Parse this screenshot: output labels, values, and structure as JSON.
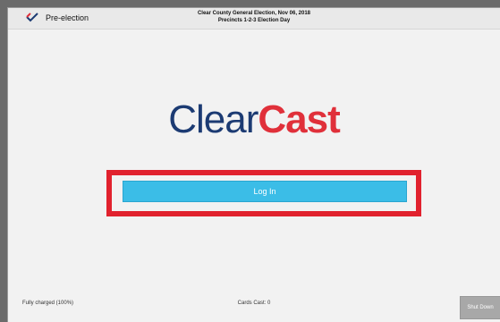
{
  "topbar": {
    "phase_label": "Pre-election",
    "election_line1": "Clear County General Election, Nov 06, 2018",
    "election_line2": "Precincts 1-2-3 Election Day",
    "logo_icon": "clearcast-checkmark-icon"
  },
  "brand": {
    "part1": "Clear",
    "part2": "Cast",
    "colors": {
      "clear": "#1c3b73",
      "cast": "#e0303a"
    }
  },
  "actions": {
    "login_label": "Log In",
    "shutdown_label": "Shut Down"
  },
  "status": {
    "battery_text": "Fully charged (100%)",
    "cards_cast_text": "Cards Cast: 0"
  },
  "colors": {
    "login_button": "#3bbde7",
    "highlight_box": "#e1222e"
  }
}
